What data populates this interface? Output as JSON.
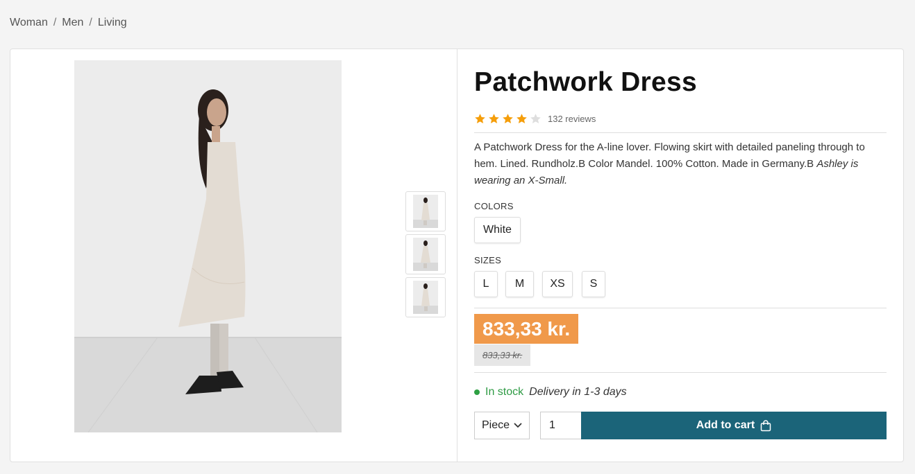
{
  "breadcrumb": {
    "items": [
      "Woman",
      "Men",
      "Living"
    ],
    "separator": "/"
  },
  "product": {
    "title": "Patchwork Dress",
    "rating": 4,
    "rating_max": 5,
    "reviews": "132 reviews",
    "description_plain": "A Patchwork Dress for the A-line lover. Flowing skirt with detailed paneling through to hem. Lined. Rundholz.B Color Mandel. 100% Cotton. Made in Germany.B ",
    "description_italic": "Ashley is wearing an X-Small.",
    "colors_label": "COLORS",
    "colors": [
      "White"
    ],
    "sizes_label": "SIZES",
    "sizes": [
      "L",
      "M",
      "XS",
      "S"
    ],
    "price": "833,33 kr.",
    "old_price": "833,33 kr.",
    "stock_status": "In stock",
    "delivery": "Delivery in 1-3 days",
    "unit": "Piece",
    "quantity": "1",
    "add_to_cart": "Add to cart"
  },
  "colors": {
    "price_bg": "#f0994a",
    "cart_bg": "#1b6479",
    "star": "#f59e0b",
    "in_stock": "#2e9b44"
  }
}
